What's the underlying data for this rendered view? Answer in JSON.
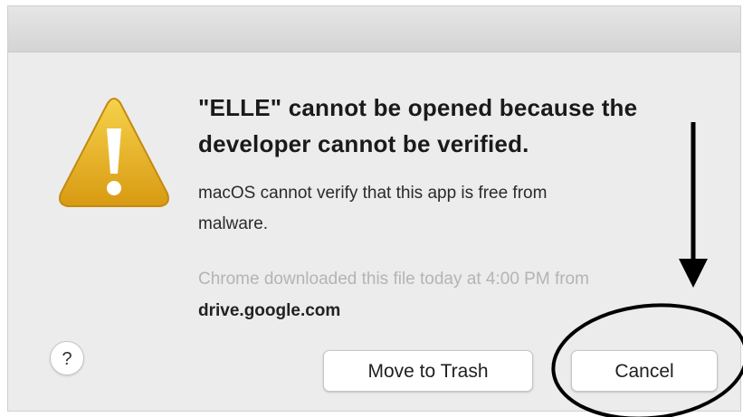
{
  "dialog": {
    "title": "\"ELLE\" cannot be opened because the developer cannot be verified.",
    "message": "macOS cannot verify that this app is free from malware.",
    "origin_text": "Chrome downloaded this file today at 4:00 PM from",
    "origin_domain": "drive.google.com",
    "help_label": "?",
    "buttons": {
      "move_to_trash": "Move to Trash",
      "cancel": "Cancel"
    }
  },
  "colors": {
    "warning_icon": "#e8b323",
    "annotation": "#000000"
  },
  "icons": {
    "warning": "warning-triangle-icon",
    "arrow": "down-arrow-icon"
  }
}
